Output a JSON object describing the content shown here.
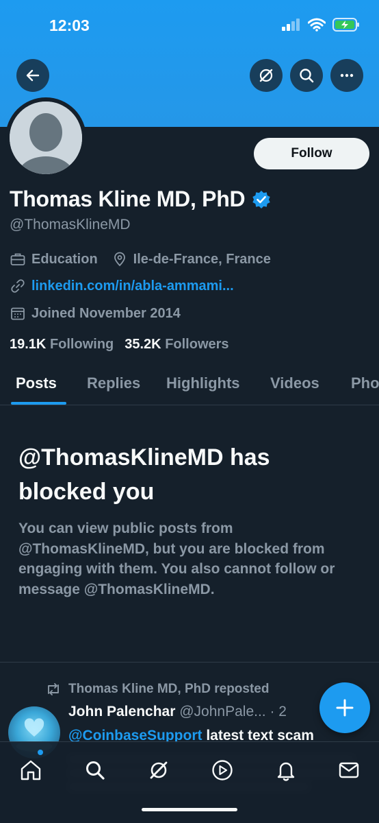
{
  "status_bar": {
    "time": "12:03"
  },
  "colors": {
    "background": "#15202b",
    "banner": "#1d9bf0",
    "accent": "#1d9bf0",
    "verified": "#1d9bf0",
    "muted": "#8b98a5"
  },
  "header": {
    "back_icon": "arrow-left-icon",
    "grok_icon": "grok-slash-icon",
    "search_icon": "search-icon",
    "more_icon": "more-horizontal-icon"
  },
  "profile": {
    "name": "Thomas Kline MD, PhD",
    "handle": "@ThomasKlineMD",
    "verified": true,
    "follow_label": "Follow",
    "category": "Education",
    "location": "Ile-de-France, France",
    "link": "linkedin.com/in/abla-ammami...",
    "joined": "Joined November 2014",
    "following_count": "19.1K",
    "following_label": "Following",
    "followers_count": "35.2K",
    "followers_label": "Followers"
  },
  "tabs": [
    {
      "label": "Posts",
      "active": true
    },
    {
      "label": "Replies",
      "active": false
    },
    {
      "label": "Highlights",
      "active": false
    },
    {
      "label": "Videos",
      "active": false
    },
    {
      "label": "Pho",
      "active": false
    }
  ],
  "blocked": {
    "title": "@ThomasKlineMD has blocked you",
    "description": "You can view public posts from @ThomasKlineMD, but you are blocked from engaging with them. You also cannot follow or message @ThomasKlineMD."
  },
  "post": {
    "repost_label": "Thomas Kline MD, PhD reposted",
    "author_name": "John Palenchar",
    "author_handle": "@JohnPale... · 2",
    "mention": "@CoinbaseSupport",
    "text": " latest text scam"
  },
  "bottom_nav": [
    "home-icon",
    "search-icon",
    "grok-icon",
    "play-icon",
    "notifications-icon",
    "messages-icon"
  ]
}
